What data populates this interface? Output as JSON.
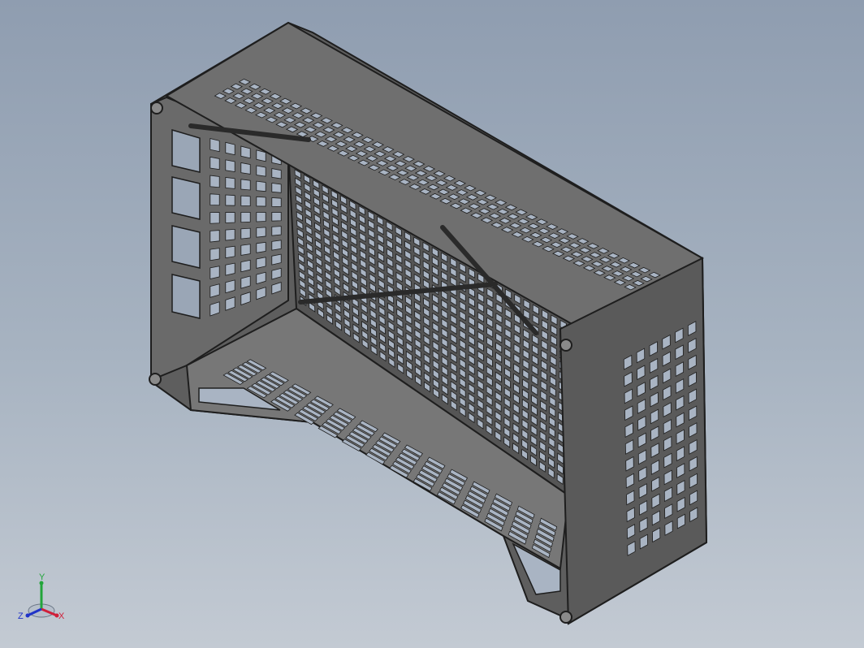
{
  "viewport": {
    "background_top": "#8f9db0",
    "background_bottom": "#c3cad3",
    "model": {
      "kind": "crate-3d-wireframe",
      "edge_color": "#1e1e1e",
      "face_dark": "#4a4a4a",
      "face_mid": "#6d6d6d",
      "face_light": "#8a8a8a",
      "hole_color": "#a9b4c3"
    }
  },
  "triad": {
    "y_label": "Y",
    "x_label": "X",
    "z_label": "Z",
    "y_color": "#22a53a",
    "x_color": "#d0203a",
    "z_color": "#2033c8"
  }
}
